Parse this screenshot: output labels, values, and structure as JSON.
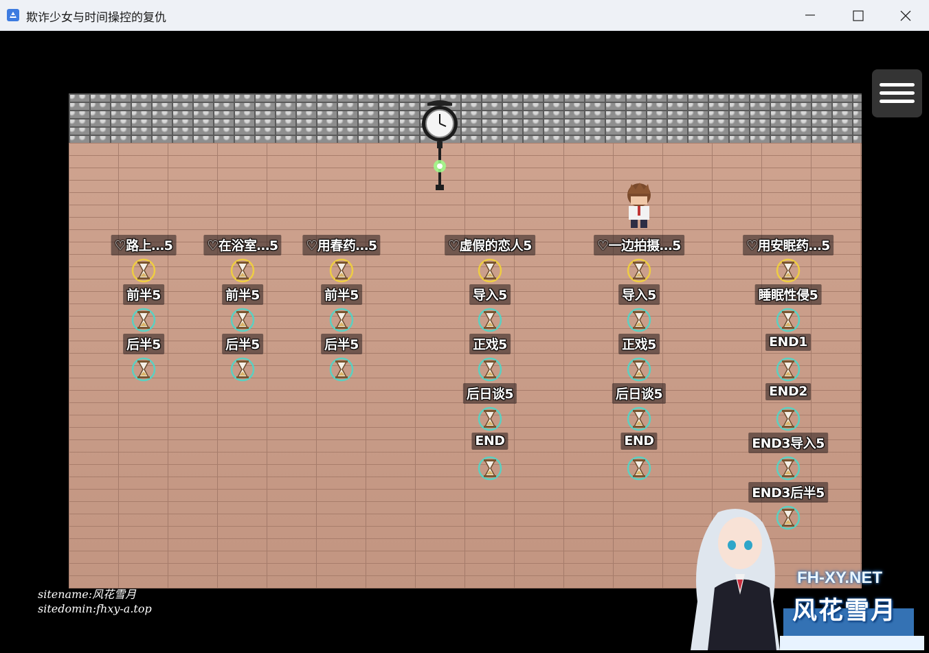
{
  "window": {
    "title": "欺诈少女与时间操控的复仇"
  },
  "columns": [
    {
      "entries": [
        "♡路上…5",
        "前半5",
        "后半5"
      ]
    },
    {
      "entries": [
        "♡在浴室…5",
        "前半5",
        "后半5"
      ]
    },
    {
      "entries": [
        "♡用春药…5",
        "前半5",
        "后半5"
      ]
    },
    {
      "entries": [
        "♡虚假的恋人5",
        "导入5",
        "正戏5",
        "后日谈5",
        "END"
      ]
    },
    {
      "entries": [
        "♡一边拍摄…5",
        "导入5",
        "正戏5",
        "后日谈5",
        "END"
      ]
    },
    {
      "entries": [
        "♡用安眠药…5",
        "睡眠性侵5",
        "END1",
        "END2",
        "END3导入5",
        "END3后半5"
      ]
    }
  ],
  "watermark": {
    "line1": "sitename:风花雪月",
    "line2": "sitedomin:fhxy-a.top",
    "logo_domain": "FH-XY.NET",
    "logo_name": "风花雪月"
  },
  "colors": {
    "hourglass_active_ring": "#f2d23a",
    "hourglass_ring": "#4fd6c8",
    "label_bg": "rgba(40,30,30,0.55)"
  }
}
